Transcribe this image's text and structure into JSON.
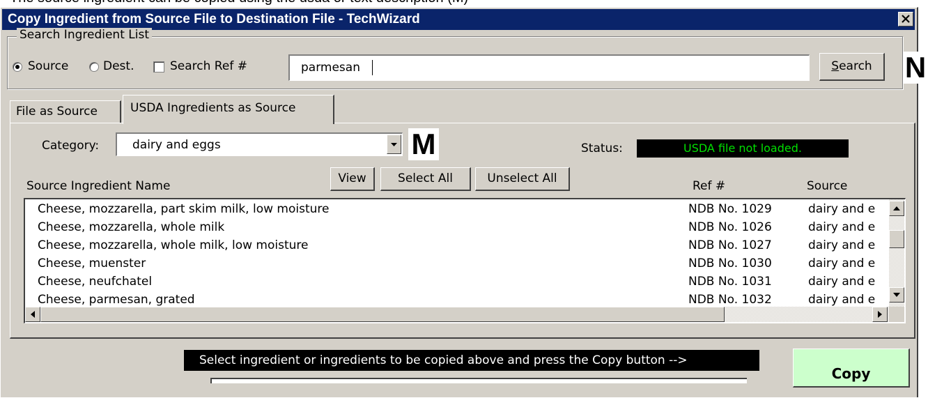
{
  "cutoff_caption": "The source ingredient can be copied using the usda or text description (M)",
  "window": {
    "title": "Copy Ingredient from Source File to Destination File - TechWizard"
  },
  "search": {
    "group_label": "Search Ingredient List",
    "radio_source": "Source",
    "radio_dest": "Dest.",
    "check_ref": "Search Ref #",
    "query": "parmesan",
    "button_prefix": "",
    "button_mnemonic": "S",
    "button_rest": "earch",
    "selected": "Source"
  },
  "callouts": {
    "n": "N",
    "m": "M"
  },
  "tabs": [
    {
      "label": "File as Source",
      "active": false
    },
    {
      "label": "USDA Ingredients as Source",
      "active": true
    }
  ],
  "category": {
    "label": "Category:",
    "value": "dairy and eggs"
  },
  "status": {
    "label": "Status:",
    "value": "USDA file not loaded.",
    "color": "#00e000"
  },
  "list": {
    "buttons": {
      "view": "View",
      "select_all": "Select All",
      "unselect_all": "Unselect All"
    },
    "headers": {
      "name": "Source Ingredient Name",
      "ref": "Ref #",
      "source": "Source"
    },
    "rows": [
      {
        "name": "Cheese, mozzarella, part skim milk, low moisture",
        "ref": "NDB No. 1029",
        "source": "dairy and e"
      },
      {
        "name": "Cheese, mozzarella, whole milk",
        "ref": "NDB No. 1026",
        "source": "dairy and e"
      },
      {
        "name": "Cheese, mozzarella, whole milk, low moisture",
        "ref": "NDB No. 1027",
        "source": "dairy and e"
      },
      {
        "name": "Cheese, muenster",
        "ref": "NDB No. 1030",
        "source": "dairy and e"
      },
      {
        "name": "Cheese, neufchatel",
        "ref": "NDB No. 1031",
        "source": "dairy and e"
      },
      {
        "name": "Cheese, parmesan, grated",
        "ref": "NDB No. 1032",
        "source": "dairy and e"
      }
    ]
  },
  "instruction": "Select ingredient or ingredients  to be copied above and press the Copy button -->",
  "copy_button": "Copy",
  "colors": {
    "titlebar": "#0a246a",
    "face": "#d4d0c8",
    "copy": "#ccffcc",
    "status_text": "#00e000"
  }
}
